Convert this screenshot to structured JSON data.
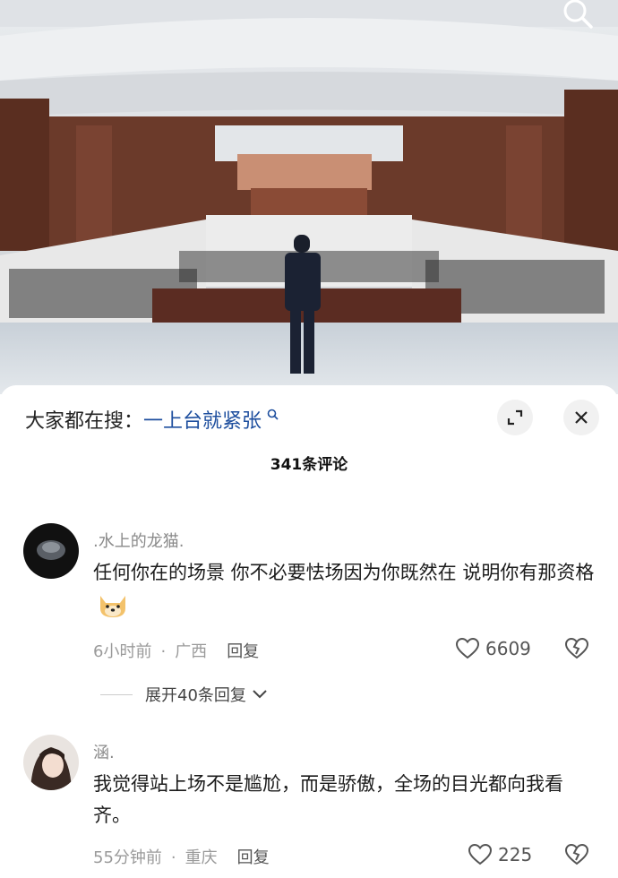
{
  "search_bar": {
    "prefix": "大家都在搜：",
    "keyword": "一上台就紧张",
    "mag": "ᵠ"
  },
  "comment_count": "341条评论",
  "comments": [
    {
      "nickname": ".水上的龙猫.",
      "text": "任何你在的场景 你不必要怯场因为你既然在 说明你有那资格",
      "emoji": "doge-emoji",
      "time": "6小时前",
      "location": "广西",
      "reply_label": "回复",
      "likes": "6609",
      "expand_label": "展开40条回复"
    },
    {
      "nickname": "涵.",
      "text": "我觉得站上场不是尴尬，而是骄傲，全场的目光都向我看齐。",
      "time": "55分钟前",
      "location": "重庆",
      "reply_label": "回复",
      "likes": "225"
    }
  ],
  "icons": {
    "search": "search-icon",
    "expand": "expand-icon",
    "close": "close-icon",
    "like": "heart-icon",
    "dislike": "broken-heart-icon",
    "chevron": "chevron-down-icon"
  },
  "colors": {
    "keyword": "#1d4e9e",
    "meta": "#9a9a9a"
  }
}
